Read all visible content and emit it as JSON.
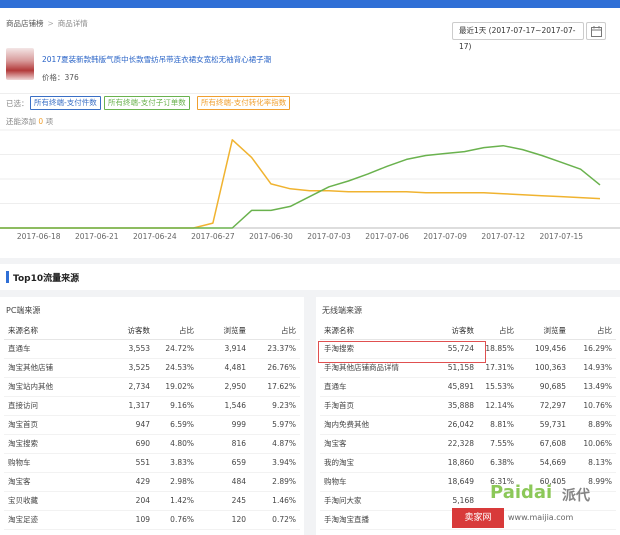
{
  "breadcrumb": {
    "root": "商品店铺榜",
    "current": "商品详情"
  },
  "date_range": "最近1天 (2017-07-17~2017-07-17)",
  "product": {
    "title": "2017夏装新款韩版气质中长款雪纺吊带连衣裙女宽松无袖背心裙子潮",
    "price_label": "价格：376"
  },
  "selected": {
    "label": "已选：",
    "tags": [
      "所有终端-支付件数",
      "所有终端-支付子订单数",
      "所有终端-支付转化率指数"
    ],
    "hint_prefix": "还能添加",
    "hint_count": "0",
    "hint_suffix": "项"
  },
  "colors": {
    "series_orange": "#f0b330",
    "series_green": "#6ab24e",
    "series_dark": "#3c8c8c",
    "accent": "#2f6fd6"
  },
  "chart_data": {
    "type": "line",
    "x": [
      "2017-06-16",
      "2017-06-17",
      "2017-06-18",
      "2017-06-19",
      "2017-06-20",
      "2017-06-21",
      "2017-06-22",
      "2017-06-23",
      "2017-06-24",
      "2017-06-25",
      "2017-06-26",
      "2017-06-27",
      "2017-06-28",
      "2017-06-29",
      "2017-06-30",
      "2017-07-01",
      "2017-07-02",
      "2017-07-03",
      "2017-07-04",
      "2017-07-05",
      "2017-07-06",
      "2017-07-07",
      "2017-07-08",
      "2017-07-09",
      "2017-07-10",
      "2017-07-11",
      "2017-07-12",
      "2017-07-13",
      "2017-07-14",
      "2017-07-15",
      "2017-07-16",
      "2017-07-17"
    ],
    "tick_labels": [
      "2017-06-18",
      "2017-06-21",
      "2017-06-24",
      "2017-06-27",
      "2017-06-30",
      "2017-07-03",
      "2017-07-06",
      "2017-07-09",
      "2017-07-12",
      "2017-07-15"
    ],
    "series": [
      {
        "name": "所有终端-支付转化率指数",
        "color": "#f0b330",
        "values": [
          0,
          0,
          0,
          0,
          0,
          0,
          0,
          0,
          0,
          0,
          0,
          5,
          90,
          72,
          45,
          40,
          38,
          38,
          37,
          37,
          37,
          37,
          36,
          36,
          36,
          36,
          35,
          34,
          33,
          32,
          31,
          30
        ]
      },
      {
        "name": "所有终端-支付子订单数",
        "color": "#6ab24e",
        "values": [
          0,
          0,
          0,
          0,
          0,
          0,
          0,
          0,
          0,
          0,
          0,
          0,
          0,
          18,
          18,
          22,
          32,
          42,
          48,
          55,
          63,
          70,
          74,
          76,
          78,
          82,
          84,
          80,
          74,
          67,
          60,
          44
        ]
      }
    ],
    "ylim": [
      0,
      100
    ],
    "grid": true,
    "legend": "none"
  },
  "section_title": "Top10流量来源",
  "pc": {
    "title": "PC端来源",
    "headers": [
      "来源名称",
      "访客数",
      "占比",
      "浏览量",
      "占比"
    ],
    "rows": [
      [
        "直通车",
        "3,553",
        "24.72%",
        "3,914",
        "23.37%"
      ],
      [
        "淘宝其他店铺",
        "3,525",
        "24.53%",
        "4,481",
        "26.76%"
      ],
      [
        "淘宝站内其他",
        "2,734",
        "19.02%",
        "2,950",
        "17.62%"
      ],
      [
        "直接访问",
        "1,317",
        "9.16%",
        "1,546",
        "9.23%"
      ],
      [
        "淘宝首页",
        "947",
        "6.59%",
        "999",
        "5.97%"
      ],
      [
        "淘宝搜索",
        "690",
        "4.80%",
        "816",
        "4.87%"
      ],
      [
        "购物车",
        "551",
        "3.83%",
        "659",
        "3.94%"
      ],
      [
        "淘宝客",
        "429",
        "2.98%",
        "484",
        "2.89%"
      ],
      [
        "宝贝收藏",
        "204",
        "1.42%",
        "245",
        "1.46%"
      ],
      [
        "淘宝足迹",
        "109",
        "0.76%",
        "120",
        "0.72%"
      ]
    ]
  },
  "mobile": {
    "title": "无线端来源",
    "headers": [
      "来源名称",
      "访客数",
      "占比",
      "浏览量",
      "占比"
    ],
    "rows": [
      [
        "手淘搜索",
        "55,724",
        "18.85%",
        "109,456",
        "16.29%"
      ],
      [
        "手淘其他店铺商品详情",
        "51,158",
        "17.31%",
        "100,363",
        "14.93%"
      ],
      [
        "直通车",
        "45,891",
        "15.53%",
        "90,685",
        "13.49%"
      ],
      [
        "手淘首页",
        "35,888",
        "12.14%",
        "72,297",
        "10.76%"
      ],
      [
        "淘内免费其他",
        "26,042",
        "8.81%",
        "59,731",
        "8.89%"
      ],
      [
        "淘宝客",
        "22,328",
        "7.55%",
        "67,608",
        "10.06%"
      ],
      [
        "我的淘宝",
        "18,860",
        "6.38%",
        "54,669",
        "8.13%"
      ],
      [
        "购物车",
        "18,649",
        "6.31%",
        "60,405",
        "8.99%"
      ],
      [
        "手淘问大家",
        "5,168",
        "",
        "",
        " "
      ],
      [
        "手淘淘宝直播",
        "",
        "",
        "",
        ""
      ]
    ]
  },
  "watermark": {
    "badge": "卖家网",
    "url": "www.maijia.com",
    "brand": "Paidai",
    "brand_cn": "派代"
  }
}
